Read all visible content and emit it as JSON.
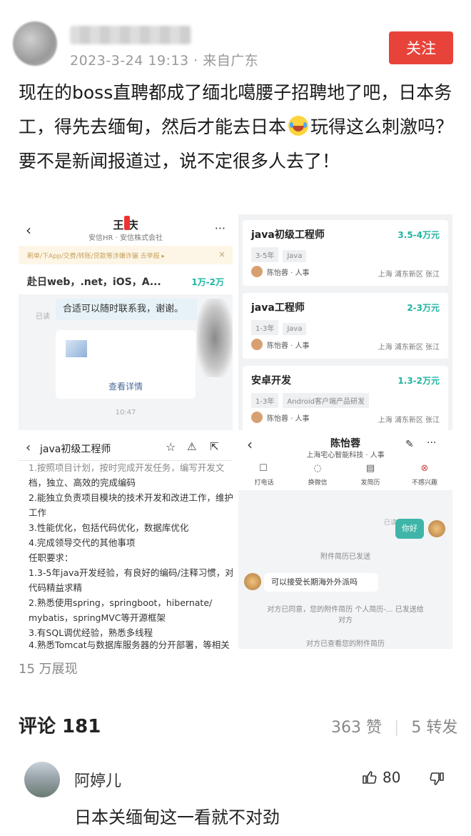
{
  "post": {
    "timestamp": "2023-3-24 19:13 · 来自广东",
    "follow_label": "关注",
    "text_part1": "现在的boss直聘都成了缅北噶腰子招聘地了吧，日本务工，得先去缅甸，然后才能去日本",
    "text_part2": "玩得这么刺激吗？要不是新闻报道过，说不定很多人去了！",
    "views": "15 万展现"
  },
  "panel1": {
    "name": "王 庆",
    "company": "安信HR · 安信株式会社",
    "warning": "刷单/下App/交费/转账/贷款等涉嫌诈骗 去举报 ▸",
    "job": "赴日web，.net，iOS，A...",
    "salary": "1万-2万",
    "read": "已读",
    "message": "合适可以随时联系我，谢谢。",
    "view_detail": "查看详情",
    "time": "10:47"
  },
  "panel2": {
    "jobs": [
      {
        "title": "java初级工程师",
        "salary": "3.5-4万元",
        "tags": [
          "3-5年",
          "Java"
        ],
        "recruiter": "陈怡蓉 · 人事",
        "location": "上海 浦东新区 张江"
      },
      {
        "title": "java工程师",
        "salary": "2-3万元",
        "tags": [
          "1-3年",
          "Java"
        ],
        "recruiter": "陈怡蓉 · 人事",
        "location": "上海 浦东新区 张江"
      },
      {
        "title": "安卓开发",
        "salary": "1.3-2万元",
        "tags": [
          "1-3年",
          "Android客户端产品研发"
        ],
        "recruiter": "陈怡蓉 · 人事",
        "location": "上海 浦东新区 张江"
      }
    ]
  },
  "panel3": {
    "title": "java初级工程师",
    "lines": [
      "1.按照项目计划，按时完成开发任务，编写开发文",
      "档，独立、高效的完成编码",
      "2.能独立负责项目模块的技术开发和改进工作，维护",
      "工作",
      "3.性能优化，包括代码优化，数据库优化",
      "4.完成领导交代的其他事项",
      "任职要求：",
      "1.3-5年java开发经验，有良好的编码/注释习惯，对",
      "代码精益求精",
      "2.熟悉使用spring，springboot，hibernate/",
      "mybatis，springMVC等开源框架",
      "3.有SQL调优经验，熟悉多线程",
      "4.熟悉Tomcat与数据库服务器的分开部署，等相关"
    ]
  },
  "panel4": {
    "name": "陈怡蓉",
    "company": "上海宅心智能科技 · 人事",
    "actions": [
      "打电话",
      "换微信",
      "发简历",
      "不感兴趣"
    ],
    "hello": "你好",
    "read": "已读",
    "sys1": "附件简历已发送",
    "question": "可以接受长期海外外派吗",
    "sys2": "对方已同意，您的附件简历 个人简历-... 已发送给对方",
    "sys3": "对方已查看您的附件简历"
  },
  "comments": {
    "header": "评论 181",
    "likes": "363 赞",
    "shares": "5 转发",
    "items": [
      {
        "user": "阿婷儿",
        "likes": "80",
        "text": "日本关缅甸这一看就不对劲"
      }
    ]
  }
}
